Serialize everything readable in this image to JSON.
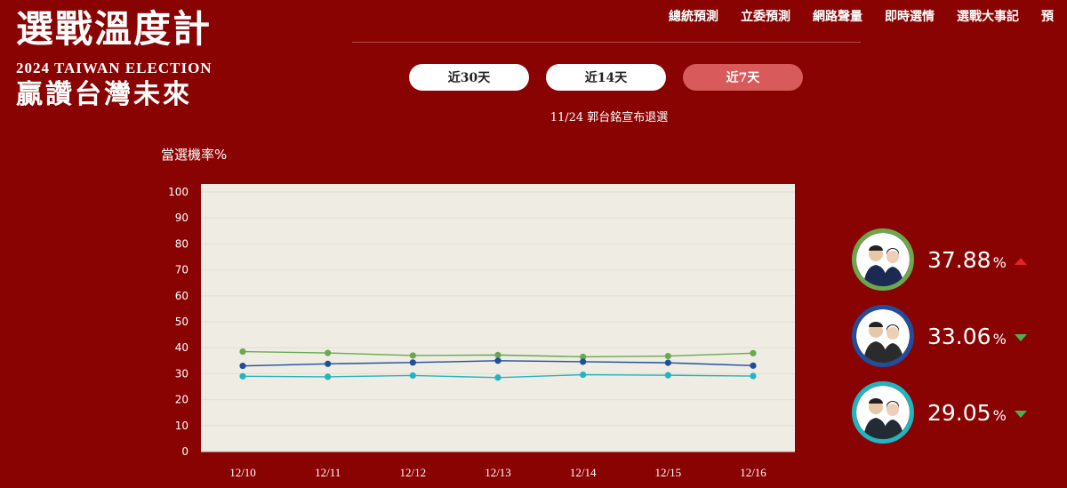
{
  "logo": {
    "title": "選戰溫度計",
    "subtitle": "2024 TAIWAN ELECTION",
    "slogan": "贏讚台灣未來"
  },
  "nav": {
    "items": [
      {
        "label": "總統預測"
      },
      {
        "label": "立委預測"
      },
      {
        "label": "網路聲量"
      },
      {
        "label": "即時選情"
      },
      {
        "label": "選戰大事記"
      },
      {
        "label": "預"
      }
    ]
  },
  "range_tabs": [
    {
      "label": "近30天",
      "active": false
    },
    {
      "label": "近14天",
      "active": false
    },
    {
      "label": "近7天",
      "active": true
    }
  ],
  "event_note": "11/24 郭台銘宣布退選",
  "chart_title": "當選機率%",
  "chart_data": {
    "type": "line",
    "title": "當選機率%",
    "xlabel": "",
    "ylabel": "",
    "categories": [
      "12/10",
      "12/11",
      "12/12",
      "12/13",
      "12/14",
      "12/15",
      "12/16"
    ],
    "ylim": [
      0,
      100
    ],
    "yticks": [
      0,
      10,
      20,
      30,
      40,
      50,
      60,
      70,
      80,
      90,
      100
    ],
    "grid": true,
    "series": [
      {
        "color": "#6aa84f",
        "values": [
          38.5,
          38.0,
          37.0,
          37.2,
          36.5,
          36.8,
          37.9
        ]
      },
      {
        "color": "#1f4e9e",
        "values": [
          33.0,
          33.8,
          34.3,
          35.0,
          34.6,
          34.2,
          33.1
        ]
      },
      {
        "color": "#1fb5c1",
        "values": [
          29.0,
          28.8,
          29.3,
          28.5,
          29.6,
          29.4,
          29.1
        ]
      }
    ]
  },
  "candidates": [
    {
      "pct": "37.88",
      "unit": "%",
      "trend": "up",
      "ring_color": "#6aa84f",
      "shirt": "#1a2a52"
    },
    {
      "pct": "33.06",
      "unit": "%",
      "trend": "down",
      "ring_color": "#1f4e9e",
      "shirt": "#2b2b2b"
    },
    {
      "pct": "29.05",
      "unit": "%",
      "trend": "down",
      "ring_color": "#1fb5c1",
      "shirt": "#222a33"
    }
  ]
}
